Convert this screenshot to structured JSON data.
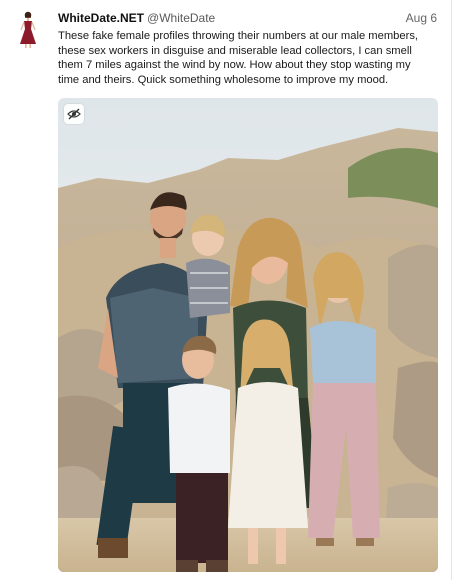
{
  "post": {
    "display_name": "WhiteDate.NET",
    "handle": "@WhiteDate",
    "date": "Aug 6",
    "text": "These fake female profiles throwing their numbers at our male members, these sex workers in disguise and miserable lead collectors, I can smell them 7 miles against the wind by now. How about they stop wasting my time and theirs. Quick something wholesome to improve my mood.",
    "avatar_icon": "woman-in-red-dress-icon",
    "media_toggle_icon": "eye-slash-icon"
  },
  "colors": {
    "name": "#111111",
    "handle": "#5a5a5a",
    "avatar_dress": "#8b1a2b"
  }
}
